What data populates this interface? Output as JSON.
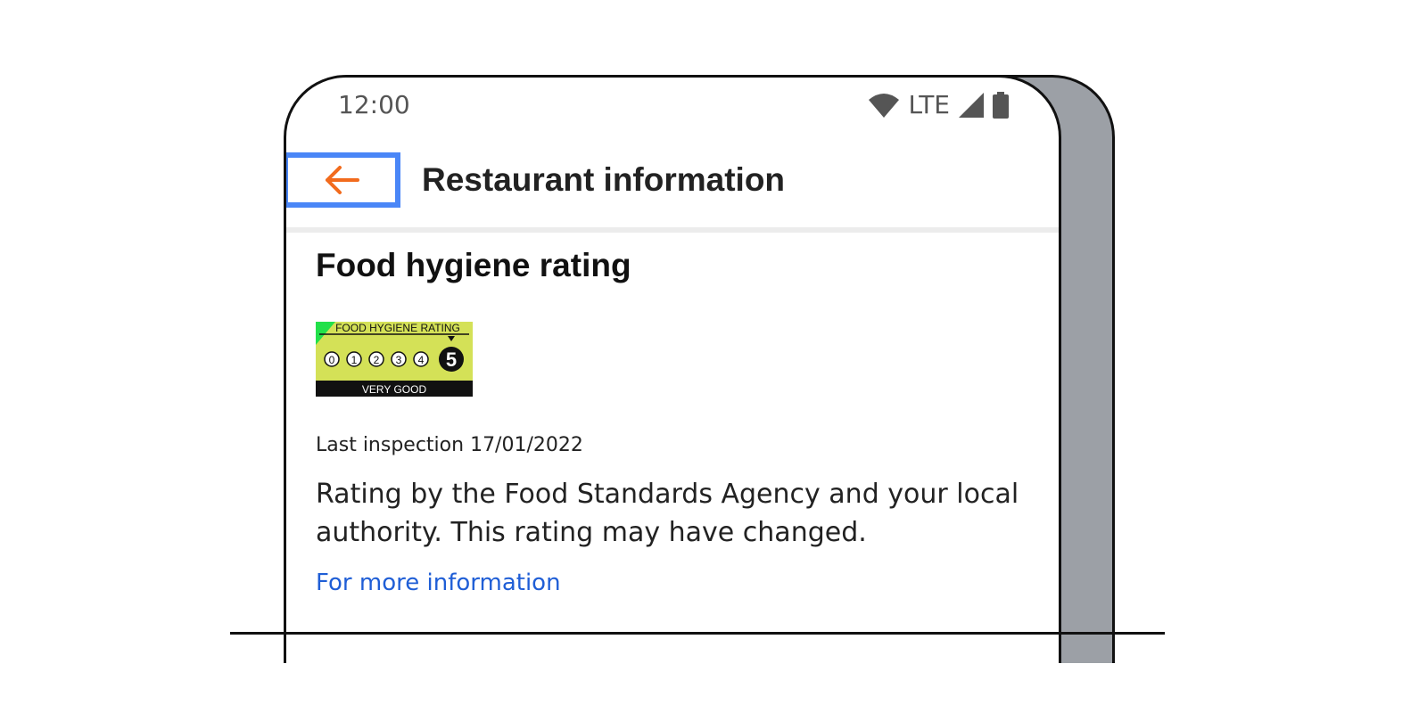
{
  "status_bar": {
    "time": "12:00",
    "network": "LTE",
    "icons": [
      "wifi-icon",
      "signal-icon",
      "battery-icon"
    ]
  },
  "app_bar": {
    "back_icon": "arrow-left-icon",
    "title": "Restaurant information"
  },
  "section": {
    "title": "Food hygiene rating",
    "badge": {
      "heading": "FOOD HYGIENE RATING",
      "scale": [
        "0",
        "1",
        "2",
        "3",
        "4",
        "5"
      ],
      "selected": "5",
      "label": "VERY GOOD"
    },
    "last_inspection": "Last inspection 17/01/2022",
    "description": "Rating by the Food Standards Agency and your local authority. This rating may have changed.",
    "link": "For more information"
  },
  "colors": {
    "accent_back": "#f26b1d",
    "focus_outline": "#4a86f7",
    "link": "#1f5ed6",
    "badge_bg": "#d4e157"
  }
}
